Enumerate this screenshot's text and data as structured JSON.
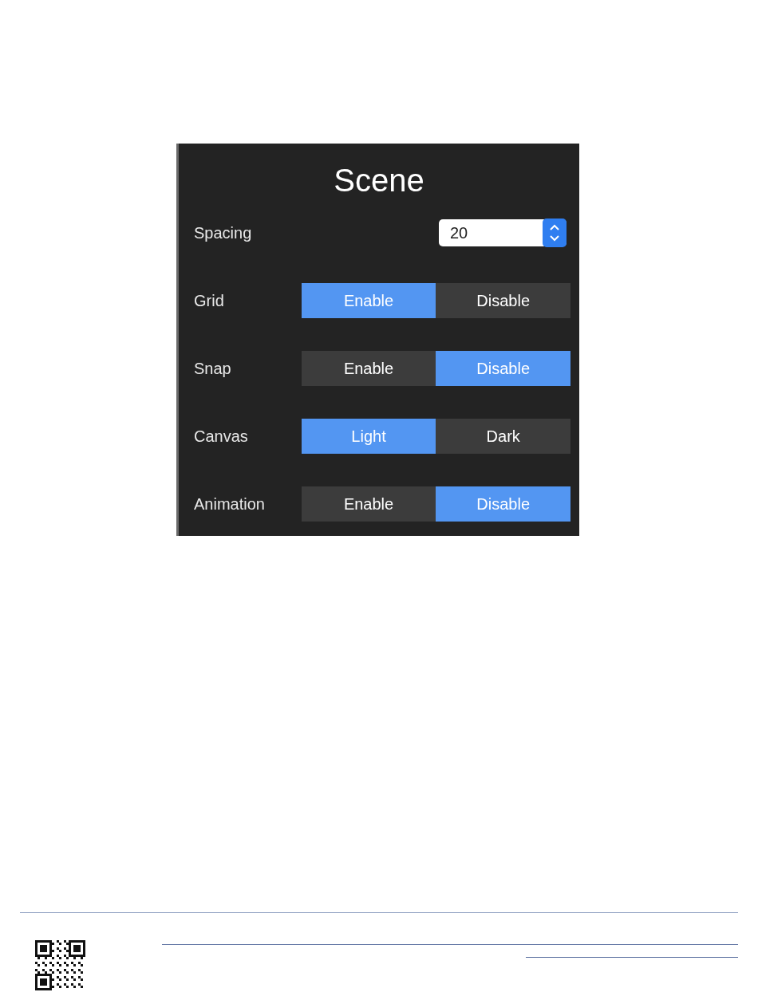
{
  "panel": {
    "title": "Scene",
    "spacing": {
      "label": "Spacing",
      "value": "20"
    },
    "options": [
      {
        "label": "Grid",
        "choices": [
          {
            "label": "Enable",
            "selected": true
          },
          {
            "label": "Disable",
            "selected": false
          }
        ]
      },
      {
        "label": "Snap",
        "choices": [
          {
            "label": "Enable",
            "selected": false
          },
          {
            "label": "Disable",
            "selected": true
          }
        ]
      },
      {
        "label": "Canvas",
        "choices": [
          {
            "label": "Light",
            "selected": true
          },
          {
            "label": "Dark",
            "selected": false
          }
        ]
      },
      {
        "label": "Animation",
        "choices": [
          {
            "label": "Enable",
            "selected": false
          },
          {
            "label": "Disable",
            "selected": true
          }
        ]
      }
    ]
  }
}
